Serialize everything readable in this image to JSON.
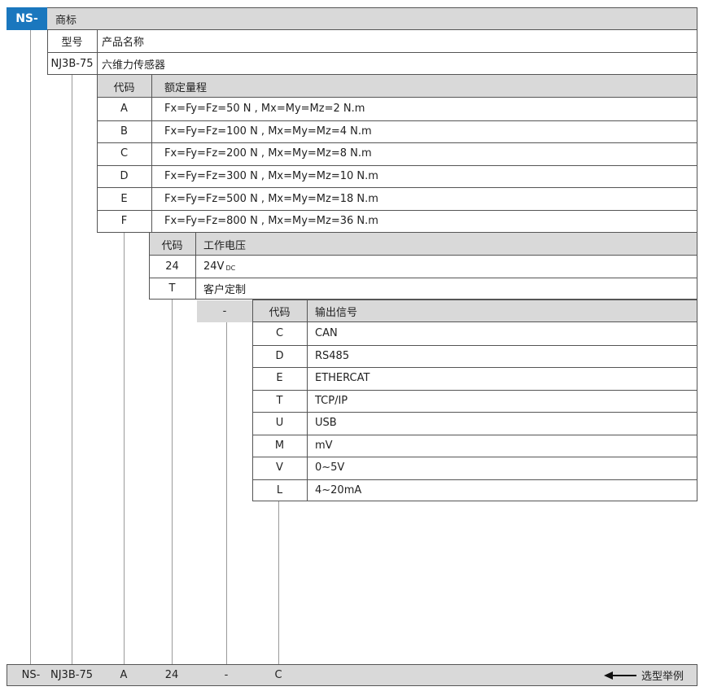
{
  "brand": {
    "prefix": "NS-",
    "label": "商标",
    "accent": "#1a77be"
  },
  "model": {
    "header_code": "型号",
    "header_name": "产品名称",
    "code": "NJ3B-75",
    "name": "六维力传感器"
  },
  "range_table": {
    "header_code": "代码",
    "header_value": "额定量程",
    "rows": [
      {
        "code": "A",
        "value": "Fx=Fy=Fz=50 N , Mx=My=Mz=2 N.m"
      },
      {
        "code": "B",
        "value": "Fx=Fy=Fz=100 N , Mx=My=Mz=4 N.m"
      },
      {
        "code": "C",
        "value": "Fx=Fy=Fz=200 N , Mx=My=Mz=8 N.m"
      },
      {
        "code": "D",
        "value": "Fx=Fy=Fz=300 N , Mx=My=Mz=10 N.m"
      },
      {
        "code": "E",
        "value": "Fx=Fy=Fz=500 N , Mx=My=Mz=18 N.m"
      },
      {
        "code": "F",
        "value": "Fx=Fy=Fz=800 N , Mx=My=Mz=36 N.m"
      }
    ]
  },
  "voltage_table": {
    "header_code": "代码",
    "header_value": "工作电压",
    "rows": [
      {
        "code": "24",
        "value": "24V",
        "sub": "DC"
      },
      {
        "code": "T",
        "value": "客户定制"
      }
    ]
  },
  "separator": "-",
  "signal_table": {
    "header_code": "代码",
    "header_value": "输出信号",
    "rows": [
      {
        "code": "C",
        "value": "CAN"
      },
      {
        "code": "D",
        "value": "RS485"
      },
      {
        "code": "E",
        "value": "ETHERCAT"
      },
      {
        "code": "T",
        "value": "TCP/IP"
      },
      {
        "code": "U",
        "value": "USB"
      },
      {
        "code": "M",
        "value": "mV"
      },
      {
        "code": "V",
        "value": "0~5V"
      },
      {
        "code": "L",
        "value": "4~20mA"
      }
    ]
  },
  "example": {
    "parts": [
      "NS-",
      "NJ3B-75",
      "A",
      "24",
      "-",
      "C"
    ],
    "label": "选型举例"
  }
}
